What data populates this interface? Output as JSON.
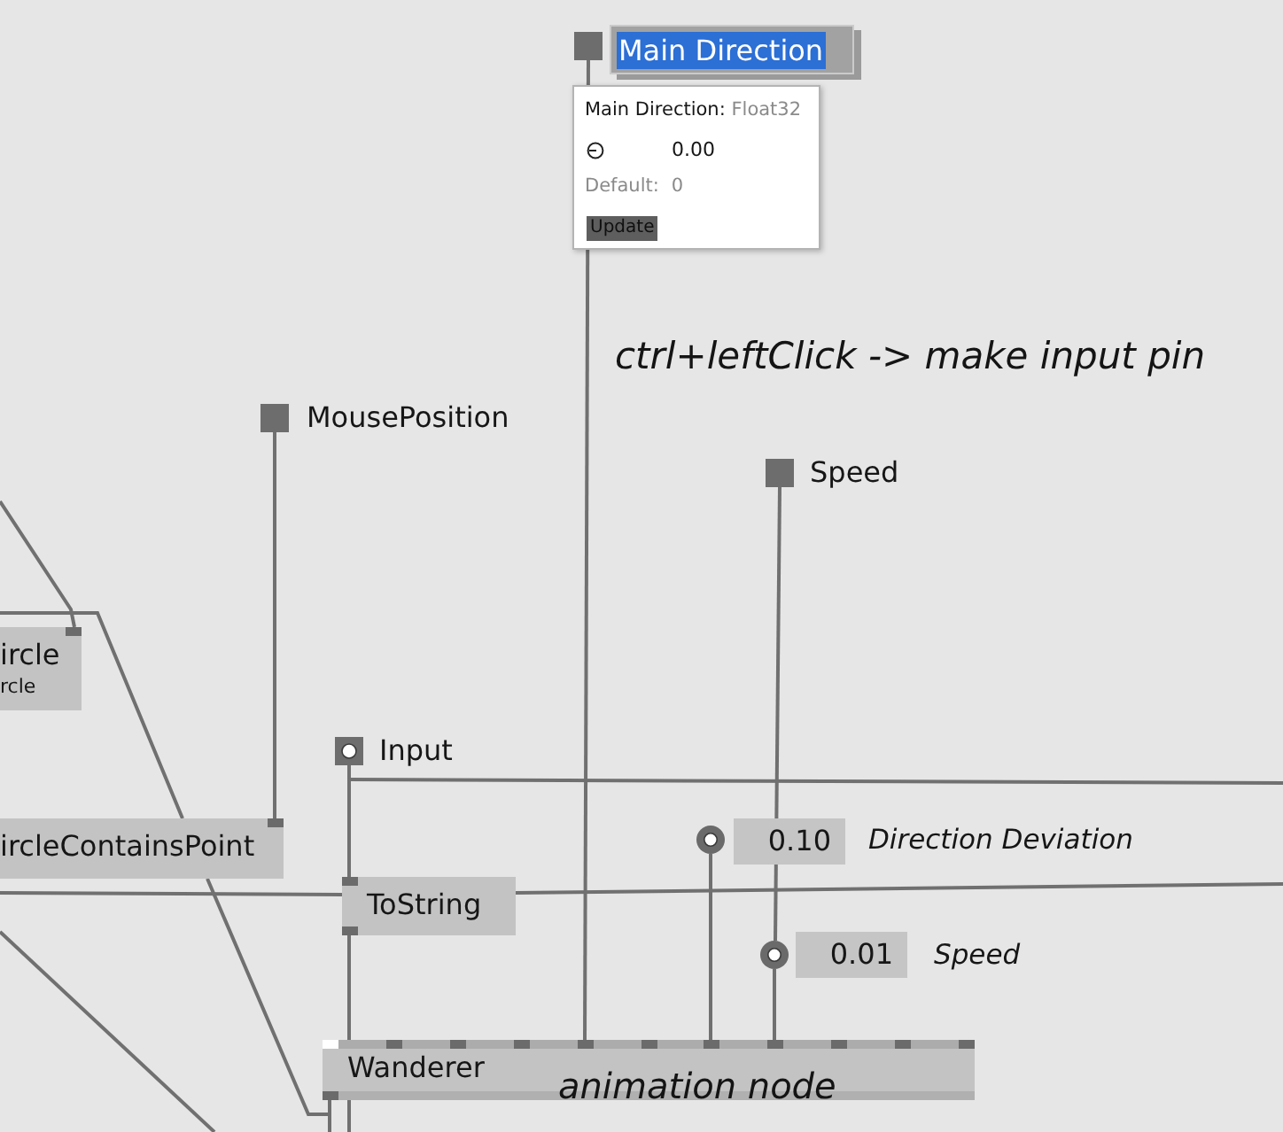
{
  "pads": [
    {
      "kind": "value",
      "label": "Main Direction",
      "editing": true
    },
    {
      "kind": "value",
      "label": "MousePosition",
      "editing": false
    },
    {
      "kind": "value",
      "label": "Speed",
      "editing": false
    },
    {
      "kind": "input",
      "label": "Input",
      "editing": false
    }
  ],
  "tooltip": {
    "title": "Main Direction:",
    "type": "Float32",
    "value": "0.00",
    "default_label": "Default:",
    "default": "0",
    "button": "Update"
  },
  "comments": [
    "ctrl+leftClick -> make input pin",
    "animation node"
  ],
  "nodes": [
    {
      "name": "ircle",
      "subtitle": "rcle",
      "input_pins": [
        {
          "hovered": false
        }
      ]
    },
    {
      "name": "ircleContainsPoint",
      "input_pins": [
        {
          "hovered": false
        }
      ]
    },
    {
      "name": "ToString",
      "input_pins": [
        {
          "hovered": false
        }
      ],
      "output_pins": [
        {
          "hovered": false
        }
      ]
    },
    {
      "name": "Wanderer",
      "input_pins": [
        {
          "hovered": true
        },
        {
          "hovered": false
        },
        {
          "hovered": false
        },
        {
          "hovered": false
        },
        {
          "hovered": false
        },
        {
          "hovered": false
        },
        {
          "hovered": false
        },
        {
          "hovered": false
        },
        {
          "hovered": false
        },
        {
          "hovered": false
        },
        {
          "hovered": false
        }
      ],
      "output_pins": [
        {
          "hovered": false
        }
      ]
    }
  ],
  "io_boxes": [
    {
      "value": "0.10",
      "label": "Direction Deviation"
    },
    {
      "value": "0.01",
      "label": "Speed"
    }
  ]
}
